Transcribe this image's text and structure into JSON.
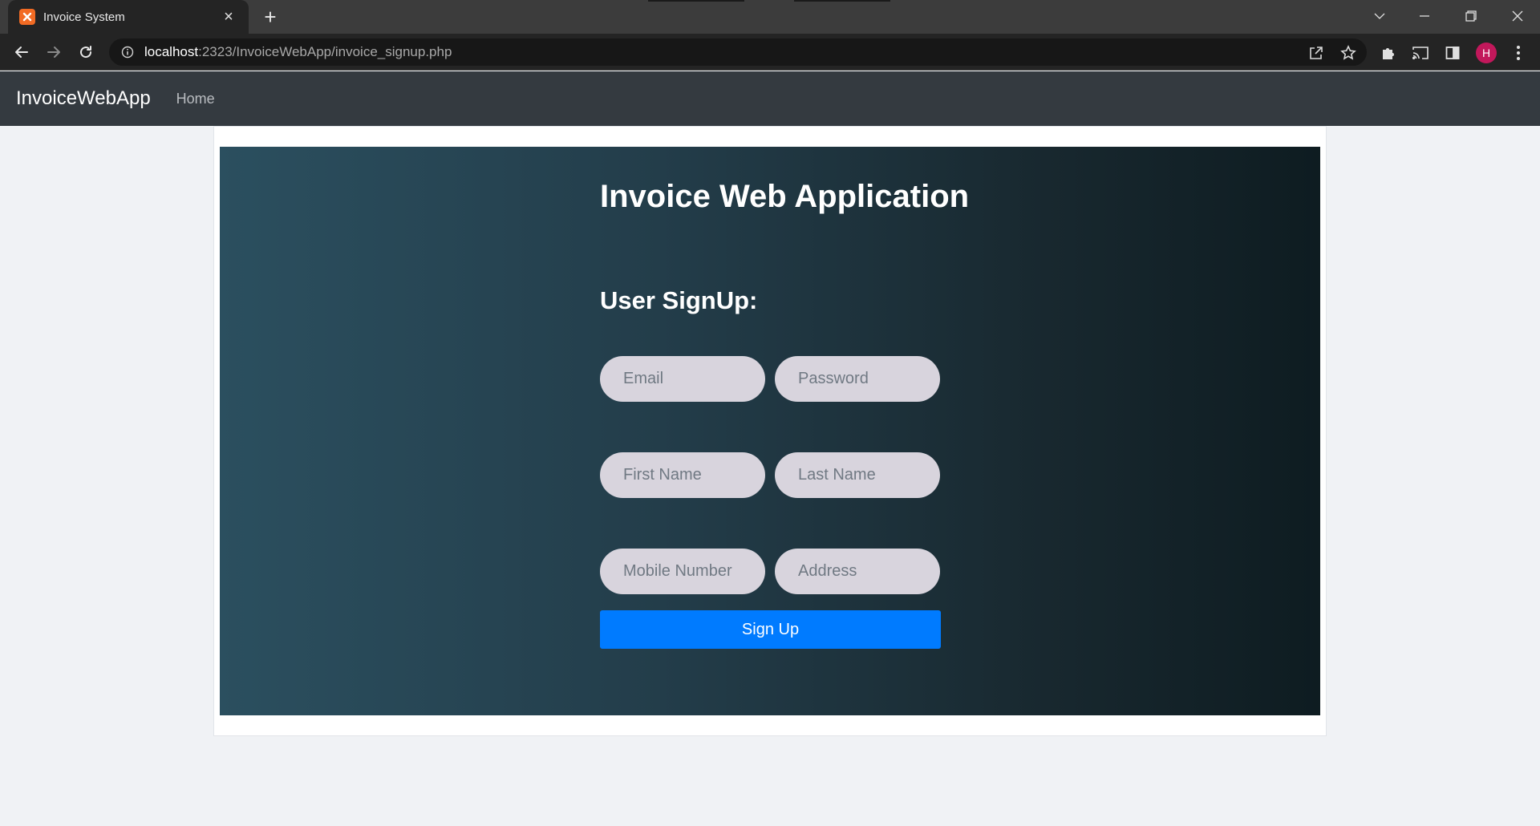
{
  "browser": {
    "tab_title": "Invoice System",
    "url_host": "localhost",
    "url_path": ":2323/InvoiceWebApp/invoice_signup.php",
    "profile_initial": "H"
  },
  "navbar": {
    "brand": "InvoiceWebApp",
    "home_link": "Home"
  },
  "main": {
    "app_title": "Invoice Web Application",
    "form_title": "User SignUp:",
    "fields": {
      "email_placeholder": "Email",
      "password_placeholder": "Password",
      "first_name_placeholder": "First Name",
      "last_name_placeholder": "Last Name",
      "mobile_placeholder": "Mobile Number",
      "address_placeholder": "Address"
    },
    "signup_button": "Sign Up"
  },
  "colors": {
    "primary_button": "#007bff",
    "navbar": "#343a40",
    "input_fill": "#d8d4dd",
    "avatar": "#c2185b"
  }
}
